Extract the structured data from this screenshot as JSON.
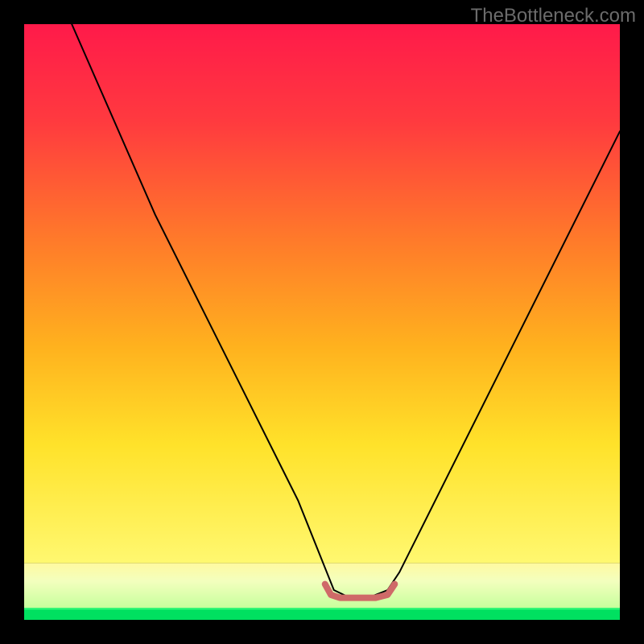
{
  "watermark": "TheBottleneck.com",
  "chart_data": {
    "type": "line",
    "title": "",
    "xlabel": "",
    "ylabel": "",
    "xlim": [
      0,
      100
    ],
    "ylim": [
      0,
      100
    ],
    "grid": false,
    "legend": false,
    "annotations": [],
    "background_bands": [
      {
        "name": "green-band",
        "y0": 98.0,
        "y1": 100.0,
        "color0": "#00E060",
        "color1": "#00E060"
      },
      {
        "name": "pale-band",
        "y0": 90.5,
        "y1": 98.0,
        "color0": "#eaffcf",
        "color1": "#d4fca6"
      },
      {
        "name": "gradient",
        "y0": 0.0,
        "y1": 90.5,
        "color0": "#ff1a4a",
        "color1": "#fff870"
      }
    ],
    "series": [
      {
        "name": "bottleneck-curve",
        "color": "#000000",
        "x": [
          8,
          15,
          22,
          30,
          38,
          46,
          50,
          52,
          54.5,
          58,
          61,
          63,
          66,
          72,
          80,
          88,
          96,
          100
        ],
        "y": [
          0,
          16,
          32,
          48,
          64,
          80,
          90,
          95,
          96.2,
          96.2,
          95,
          92,
          86,
          74,
          58,
          42,
          26,
          18
        ]
      }
    ],
    "flat_segment": {
      "name": "optimal-range-marker",
      "color": "#cf6a68",
      "width": 8,
      "x": [
        50.5,
        51.5,
        53,
        55,
        57,
        59,
        61,
        62.2
      ],
      "y": [
        94.0,
        95.8,
        96.3,
        96.3,
        96.3,
        96.3,
        95.8,
        94.0
      ]
    }
  }
}
